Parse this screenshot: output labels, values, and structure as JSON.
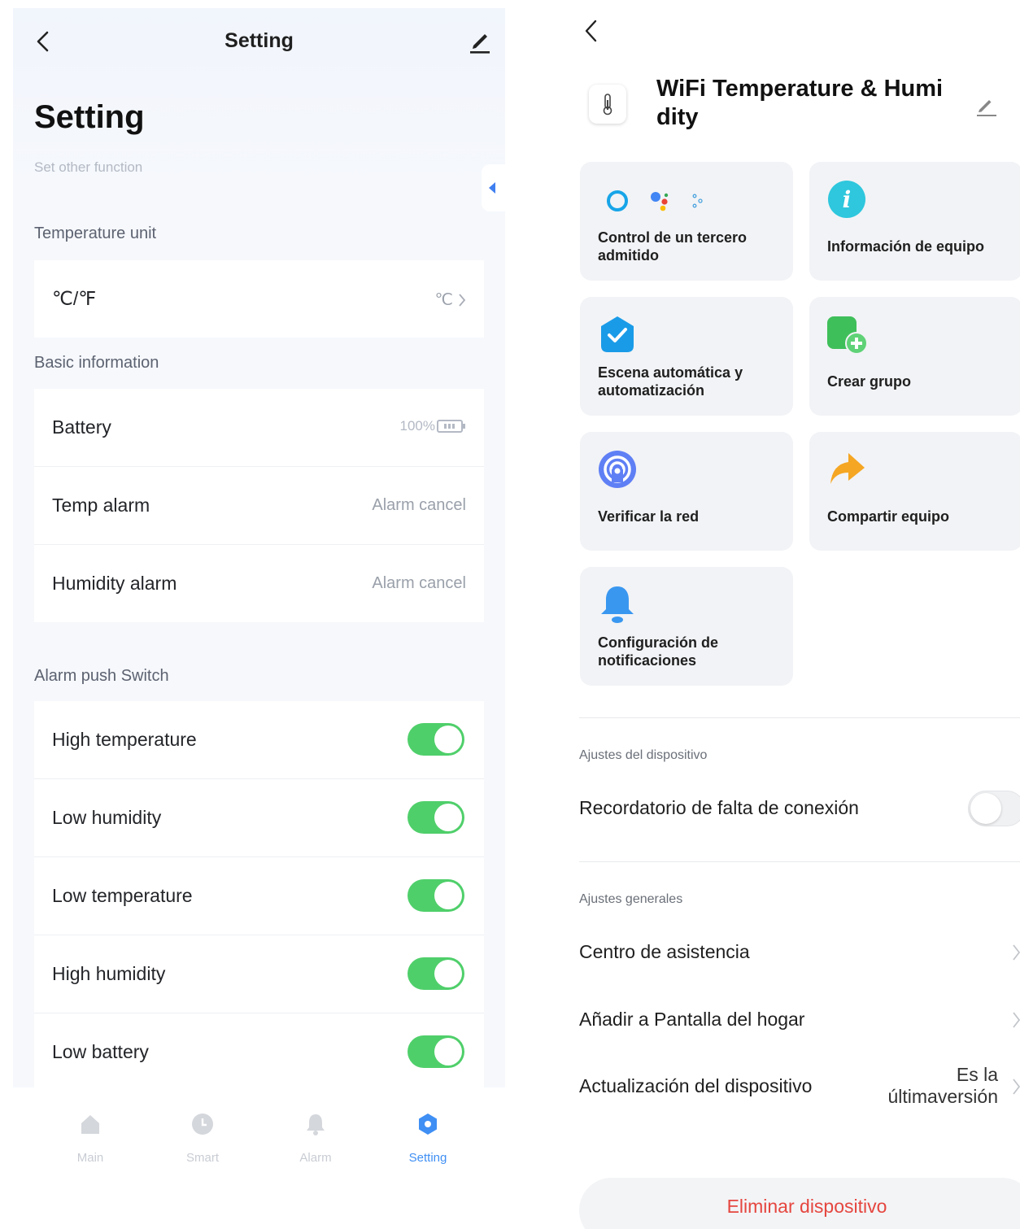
{
  "left": {
    "header_title": "Setting",
    "page_title": "Setting",
    "subtitle": "Set other function",
    "sections": {
      "unit": "Temperature unit",
      "basic": "Basic information",
      "alarm": "Alarm push Switch"
    },
    "unit_row": {
      "label": "℃/℉",
      "value": "℃"
    },
    "basic_rows": [
      {
        "label": "Battery",
        "value": "100%"
      },
      {
        "label": "Temp alarm",
        "value": "Alarm cancel"
      },
      {
        "label": "Humidity alarm",
        "value": "Alarm cancel"
      }
    ],
    "switches": [
      {
        "label": "High temperature",
        "on": true
      },
      {
        "label": "Low humidity",
        "on": true
      },
      {
        "label": "Low temperature",
        "on": true
      },
      {
        "label": "High humidity",
        "on": true
      },
      {
        "label": "Low battery",
        "on": true
      }
    ],
    "nav": [
      {
        "label": "Main",
        "icon": "home-icon"
      },
      {
        "label": "Smart",
        "icon": "clock-icon"
      },
      {
        "label": "Alarm",
        "icon": "bell-icon"
      },
      {
        "label": "Setting",
        "icon": "settings-icon",
        "active": true
      }
    ]
  },
  "right": {
    "device_name": "WiFi Temperature & Humi dity",
    "tiles": [
      {
        "label": "Control de un tercero admitido",
        "icon": "voice-assistants-icon"
      },
      {
        "label": "Información de equipo",
        "icon": "info-icon"
      },
      {
        "label": "Escena automática y automatización",
        "icon": "check-shield-icon"
      },
      {
        "label": "Crear grupo",
        "icon": "group-add-icon"
      },
      {
        "label": "Verificar la red",
        "icon": "network-icon"
      },
      {
        "label": "Compartir equipo",
        "icon": "share-icon"
      },
      {
        "label": "Configuración de notificaciones",
        "icon": "notification-bell-icon"
      }
    ],
    "device_settings_header": "Ajustes del dispositivo",
    "offline_reminder": {
      "label": "Recordatorio de falta de conexión",
      "on": false
    },
    "general_settings_header": "Ajustes generales",
    "general_rows": [
      {
        "label": "Centro de asistencia"
      },
      {
        "label": "Añadir a Pantalla del hogar"
      },
      {
        "label": "Actualización del dispositivo",
        "value_line1": "Es la",
        "value_line2": "últimaversión"
      }
    ],
    "delete_label": "Eliminar dispositivo",
    "colors": {
      "accent_green": "#4fcf6a",
      "delete_red": "#e5463f",
      "active_blue": "#3f8ff4"
    }
  }
}
